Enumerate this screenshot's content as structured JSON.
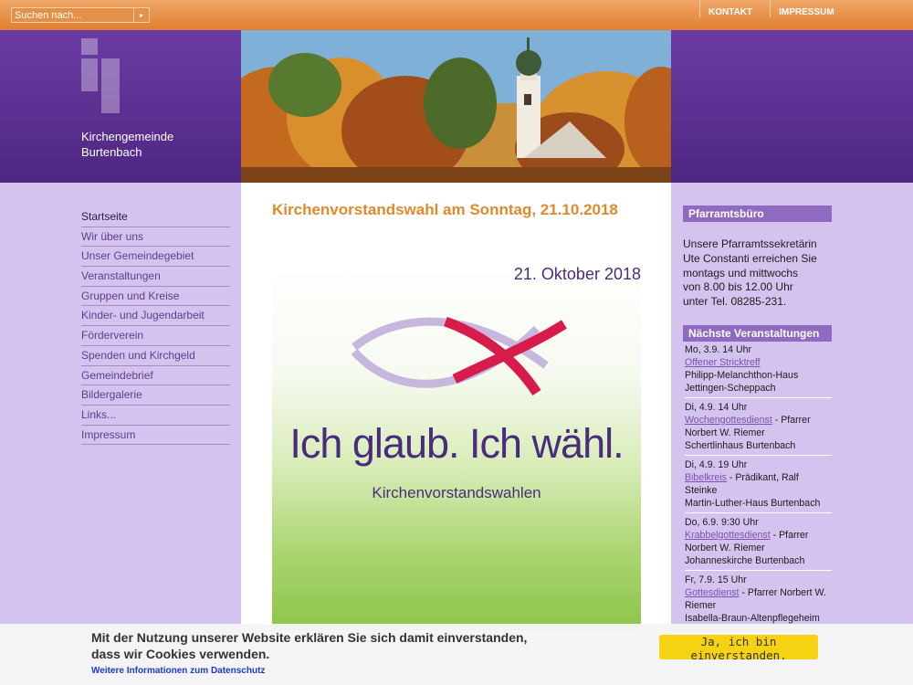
{
  "search": {
    "placeholder": "Suchen nach...",
    "button_glyph": "▸"
  },
  "toplinks": [
    "KONTAKT",
    "IMPRESSUM"
  ],
  "site": {
    "title_line1": "Kirchengemeinde",
    "title_line2": "Burtenbach"
  },
  "nav": {
    "active": 0,
    "items": [
      "Startseite",
      "Wir über uns",
      "Unser Gemeindegebiet",
      "Veranstaltungen",
      "Gruppen und Kreise",
      "Kinder- und Jugendarbeit",
      "Förderverein",
      "Spenden und Kirchgeld",
      "Gemeindebrief",
      "Bildergalerie",
      "Links...",
      "Impressum"
    ]
  },
  "article": {
    "title": "Kirchenvorstandswahl am Sonntag, 21.10.2018",
    "poster": {
      "date": "21. Oktober 2018",
      "slogan": "Ich glaub. Ich wähl.",
      "subtitle": "Kirchenvorstandswahlen"
    }
  },
  "office": {
    "heading": "Pfarramtsbüro",
    "lines": [
      "Unsere Pfarramtssekretärin",
      "Ute Constanti erreichen Sie",
      "montags und mittwochs",
      "von 8.00 bis 12.00 Uhr",
      "unter Tel. 08285-231."
    ]
  },
  "events": {
    "heading": "Nächste Veranstaltungen",
    "items": [
      {
        "date": "Mo, 3.9. 14 Uhr",
        "link": "Offener Stricktreff",
        "after": "",
        "place": "Philipp-Melanchthon-Haus Jettingen-Scheppach"
      },
      {
        "date": "Di, 4.9. 14 Uhr",
        "link": "Wochengottesdienst",
        "after": " - Pfarrer Norbert W. Riemer",
        "place": "Schertlinhaus Burtenbach"
      },
      {
        "date": "Di, 4.9. 19 Uhr",
        "link": "Bibelkreis",
        "after": " - Prädikant, Ralf Steinke",
        "place": "Martin-Luther-Haus Burtenbach"
      },
      {
        "date": "Do, 6.9. 9:30 Uhr",
        "link": "Krabbelgottesdienst",
        "after": " - Pfarrer Norbert W. Riemer",
        "place": "Johanneskirche Burtenbach"
      },
      {
        "date": "Fr, 7.9. 15 Uhr",
        "link": "Gottesdienst",
        "after": " - Pfarrer Norbert W. Riemer",
        "place": "Isabella-Braun-Altenpflegeheim Jettingen"
      }
    ]
  },
  "cookie": {
    "text_line1": "Mit der Nutzung unserer Website erklären Sie sich damit einverstanden,",
    "text_line2": "dass wir Cookies verwenden.",
    "link": "Weitere Informationen zum Datenschutz",
    "button": "Ja, ich bin einverstanden."
  },
  "colors": {
    "orange": "#e08a2c",
    "purple_dark": "#4d2682",
    "lavender": "#d3c3ee",
    "cookie_button": "#f5d312"
  }
}
